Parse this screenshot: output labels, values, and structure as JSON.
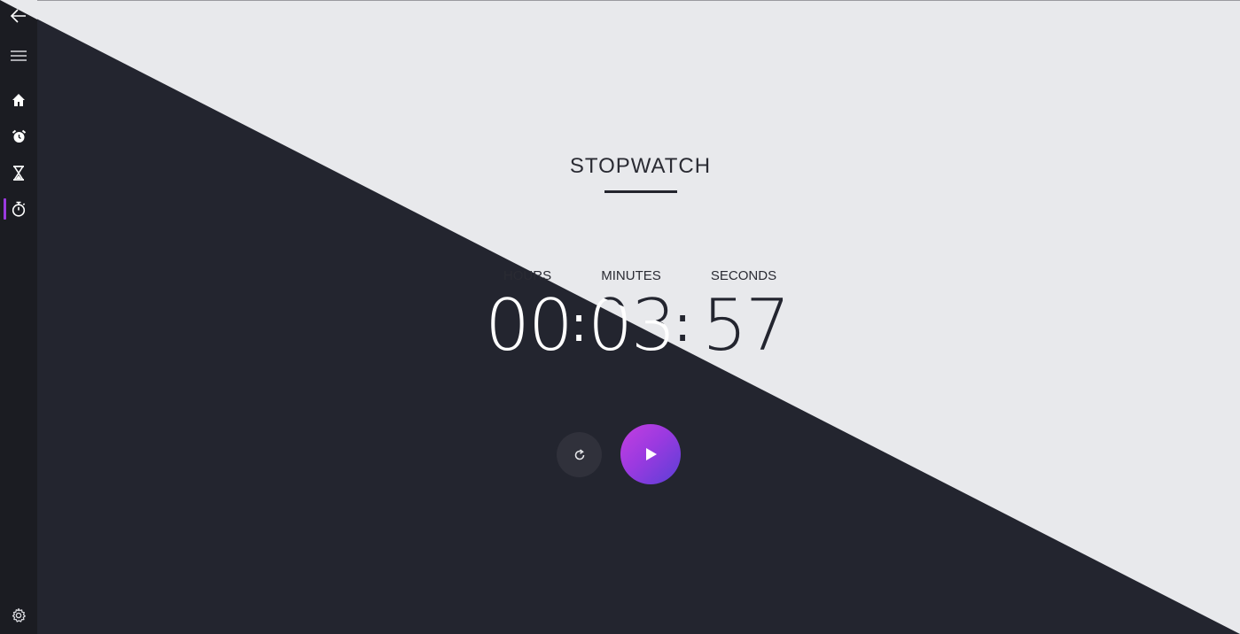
{
  "window": {
    "title": "STOPWATCH"
  },
  "sidebar": {
    "items": [
      {
        "icon": "back-arrow-icon"
      },
      {
        "icon": "hamburger-menu-icon"
      },
      {
        "icon": "home-icon"
      },
      {
        "icon": "alarm-clock-icon"
      },
      {
        "icon": "hourglass-icon"
      },
      {
        "icon": "stopwatch-icon",
        "active": true
      },
      {
        "icon": "gear-icon"
      }
    ]
  },
  "stopwatch": {
    "labels": {
      "hours": "HOURS",
      "minutes": "MINUTES",
      "seconds": "SECONDS"
    },
    "values": {
      "hours": "00",
      "minutes": "03",
      "seconds": "57"
    },
    "separator": ":"
  },
  "controls": {
    "reset_icon": "refresh-icon",
    "play_icon": "play-icon"
  },
  "colors": {
    "dark": "#23252f",
    "light": "#e8e9ec",
    "sidebar": "#1b1c22",
    "accent": "#9b3ae0",
    "accent_gradient_start": "#c43fe0",
    "accent_gradient_end": "#5a3fd6"
  }
}
